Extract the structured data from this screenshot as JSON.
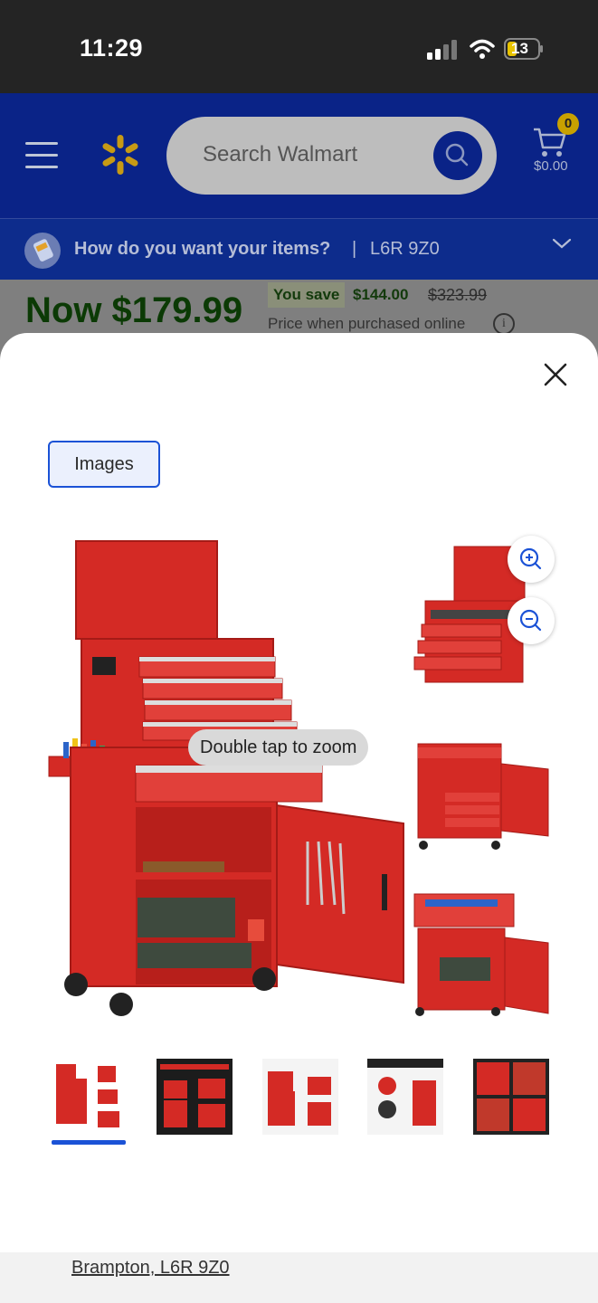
{
  "status_bar": {
    "time": "11:29",
    "battery": "13"
  },
  "header": {
    "search_placeholder": "Search Walmart",
    "cart_count": "0",
    "cart_total": "$0.00"
  },
  "delivery": {
    "question": "How do you want your items?",
    "separator": "|",
    "postal": "L6R 9Z0"
  },
  "price": {
    "now": "Now $179.99",
    "you_save_label": "You save",
    "save_amount": "$144.00",
    "was": "$323.99",
    "note": "Price when purchased online",
    "info_glyph": "i"
  },
  "modal": {
    "tab_images": "Images",
    "tap_hint": "Double tap to zoom",
    "thumbnails": [
      {
        "name": "thumb-1"
      },
      {
        "name": "thumb-2"
      },
      {
        "name": "thumb-3"
      },
      {
        "name": "thumb-4"
      },
      {
        "name": "thumb-5"
      }
    ],
    "selected_thumb": 1
  },
  "footer": {
    "location": "Brampton, L6R 9Z0"
  },
  "colors": {
    "header_bg": "#0a2387",
    "accent_blue": "#1b52d6",
    "spark_yellow": "#c79a14",
    "product_red": "#d42a25",
    "price_green": "#0b3a05"
  },
  "icons": [
    "hamburger-icon",
    "spark-logo-icon",
    "search-icon",
    "cart-icon",
    "delivery-icon",
    "chevron-down-icon",
    "info-icon",
    "close-icon",
    "zoom-in-icon",
    "zoom-out-icon",
    "signal-icon",
    "wifi-icon",
    "battery-icon"
  ]
}
